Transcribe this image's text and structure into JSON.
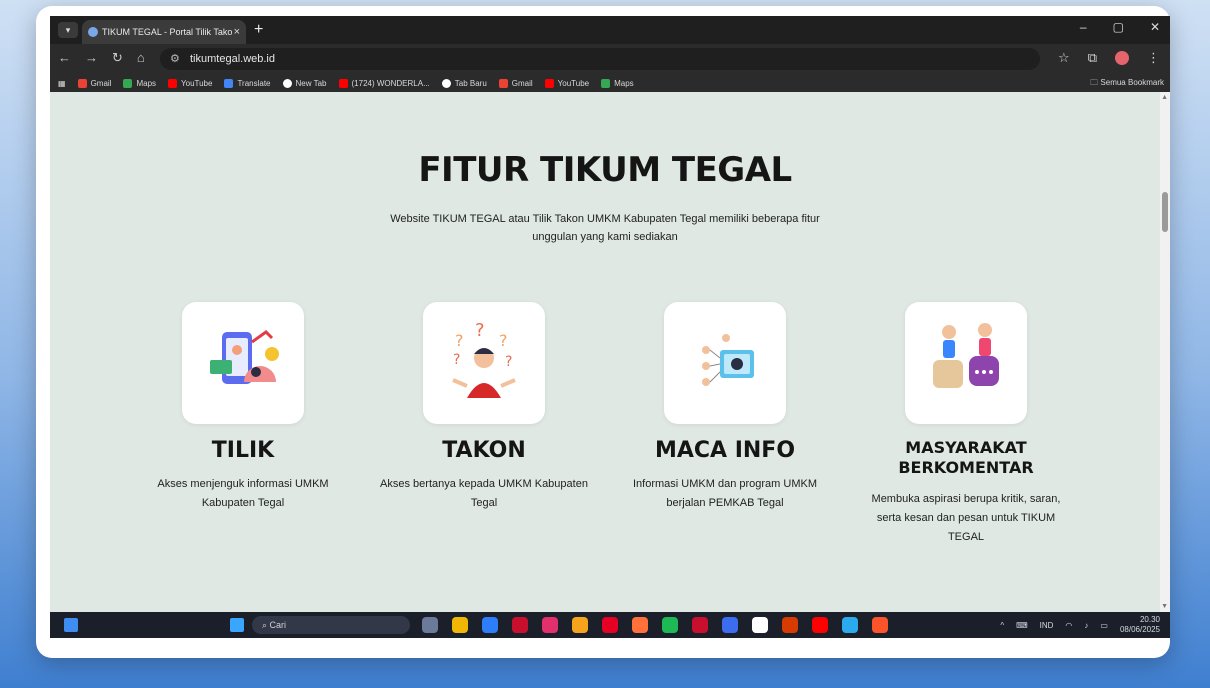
{
  "browser": {
    "tab_title": "TIKUM TEGAL - Portal Tilik Tako",
    "tab_close": "×",
    "new_tab": "+",
    "url": "tikumtegal.web.id",
    "window_controls": [
      "–",
      "▢",
      "✕"
    ],
    "nav": {
      "back": "←",
      "forward": "→",
      "reload": "↻",
      "home": "⌂"
    },
    "bookmarks": [
      {
        "label": "Gmail",
        "color": "#ea4335"
      },
      {
        "label": "Maps",
        "color": "#34a853"
      },
      {
        "label": "YouTube",
        "color": "#ff0000"
      },
      {
        "label": "Translate",
        "color": "#4285f4"
      },
      {
        "label": "New Tab",
        "color": "#ffffff"
      },
      {
        "label": "(1724) WONDERLA...",
        "color": "#ff0000"
      },
      {
        "label": "Tab Baru",
        "color": "#ffffff"
      },
      {
        "label": "Gmail",
        "color": "#ea4335"
      },
      {
        "label": "YouTube",
        "color": "#ff0000"
      },
      {
        "label": "Maps",
        "color": "#34a853"
      }
    ],
    "all_bookmarks": "Semua Bookmark"
  },
  "page": {
    "title": "FITUR TIKUM TEGAL",
    "subtitle": "Website TIKUM TEGAL atau Tilik Takon UMKM Kabupaten Tegal memiliki beberapa fitur unggulan yang kami sediakan",
    "features": [
      {
        "title": "TILIK",
        "desc": "Akses menjenguk informasi UMKM Kabupaten Tegal",
        "icon": "analytics-phone-icon"
      },
      {
        "title": "TAKON",
        "desc": "Akses bertanya kepada UMKM Kabupaten Tegal",
        "icon": "question-person-icon"
      },
      {
        "title": "MACA INFO",
        "desc": "Informasi UMKM dan program UMKM berjalan PEMKAB Tegal",
        "icon": "info-network-icon"
      },
      {
        "title": "MASYARAKAT BERKOMENTAR",
        "desc": "Membuka aspirasi berupa kritik, saran, serta kesan dan pesan untuk TIKUM TEGAL",
        "icon": "comment-people-icon"
      }
    ]
  },
  "taskbar": {
    "search_placeholder": "Cari",
    "language": "IND",
    "time": "20.30",
    "date": "08/06/2025",
    "app_colors": [
      "#6b7a99",
      "#f2b705",
      "#2d7ff9",
      "#c8102e",
      "#e1306c",
      "#f7a41d",
      "#e60023",
      "#ff7139",
      "#1db954",
      "#c8102e",
      "#3c6df0",
      "#ffffff",
      "#d83b01",
      "#ff0000",
      "#2aabee",
      "#fb542b"
    ]
  },
  "accent": "#dfe8e3"
}
